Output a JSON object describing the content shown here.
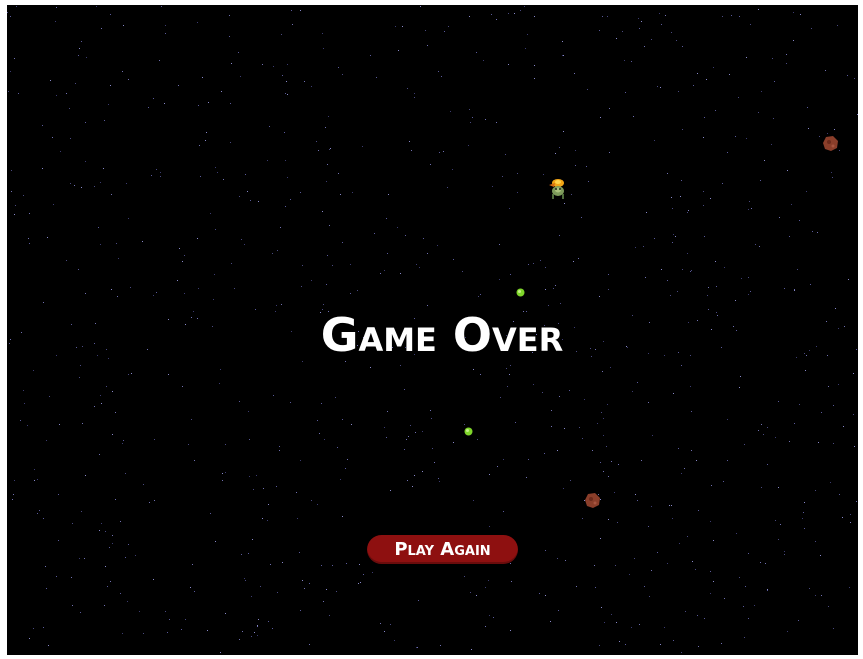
{
  "screen": {
    "title": "Game Over",
    "play_again_label": "Play Again"
  },
  "colors": {
    "background": "#000000",
    "frame": "#ffffff",
    "title_text": "#ffffff",
    "button_bg": "#8e1010",
    "button_text": "#ffffff",
    "projectile": "#7fd62a",
    "asteroid": "#8a3e2a",
    "star": "#c8c8ff"
  },
  "sprites": {
    "ship": "alien-ship-icon",
    "asteroid": "asteroid-icon",
    "projectile": "green-orb-icon"
  }
}
